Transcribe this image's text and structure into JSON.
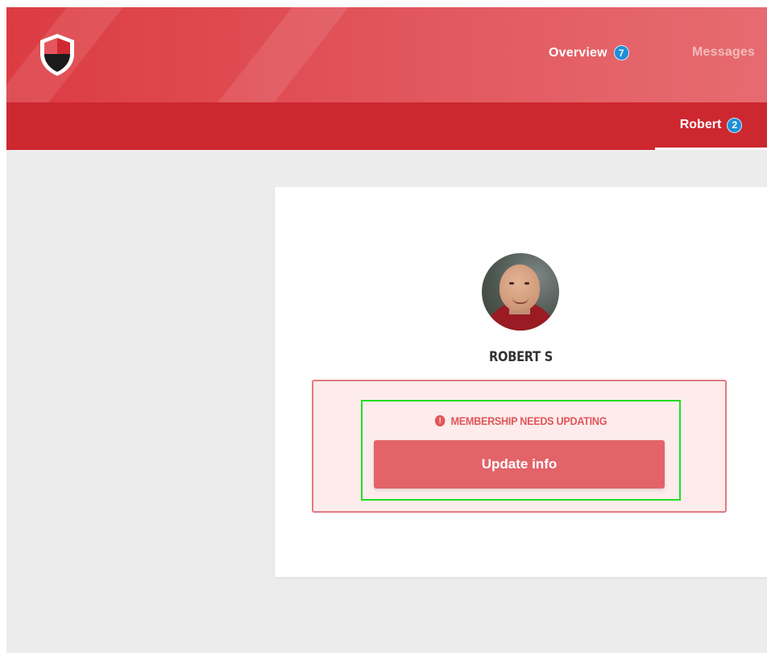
{
  "header": {
    "nav": [
      {
        "label": "Overview",
        "badge": "7"
      },
      {
        "label": "Messages"
      }
    ],
    "subnav": {
      "label": "Robert",
      "badge": "2"
    }
  },
  "profile": {
    "name": "ROBERT S",
    "alert": {
      "message": "MEMBERSHIP NEEDS UPDATING",
      "button_label": "Update info"
    }
  },
  "colors": {
    "brand_red": "#dc3b42",
    "brand_red_dark": "#cd2730",
    "badge_blue": "#1e8fd8",
    "alert_red": "#e0565b"
  },
  "icons": [
    "shield-logo-icon",
    "info-circle-icon"
  ]
}
